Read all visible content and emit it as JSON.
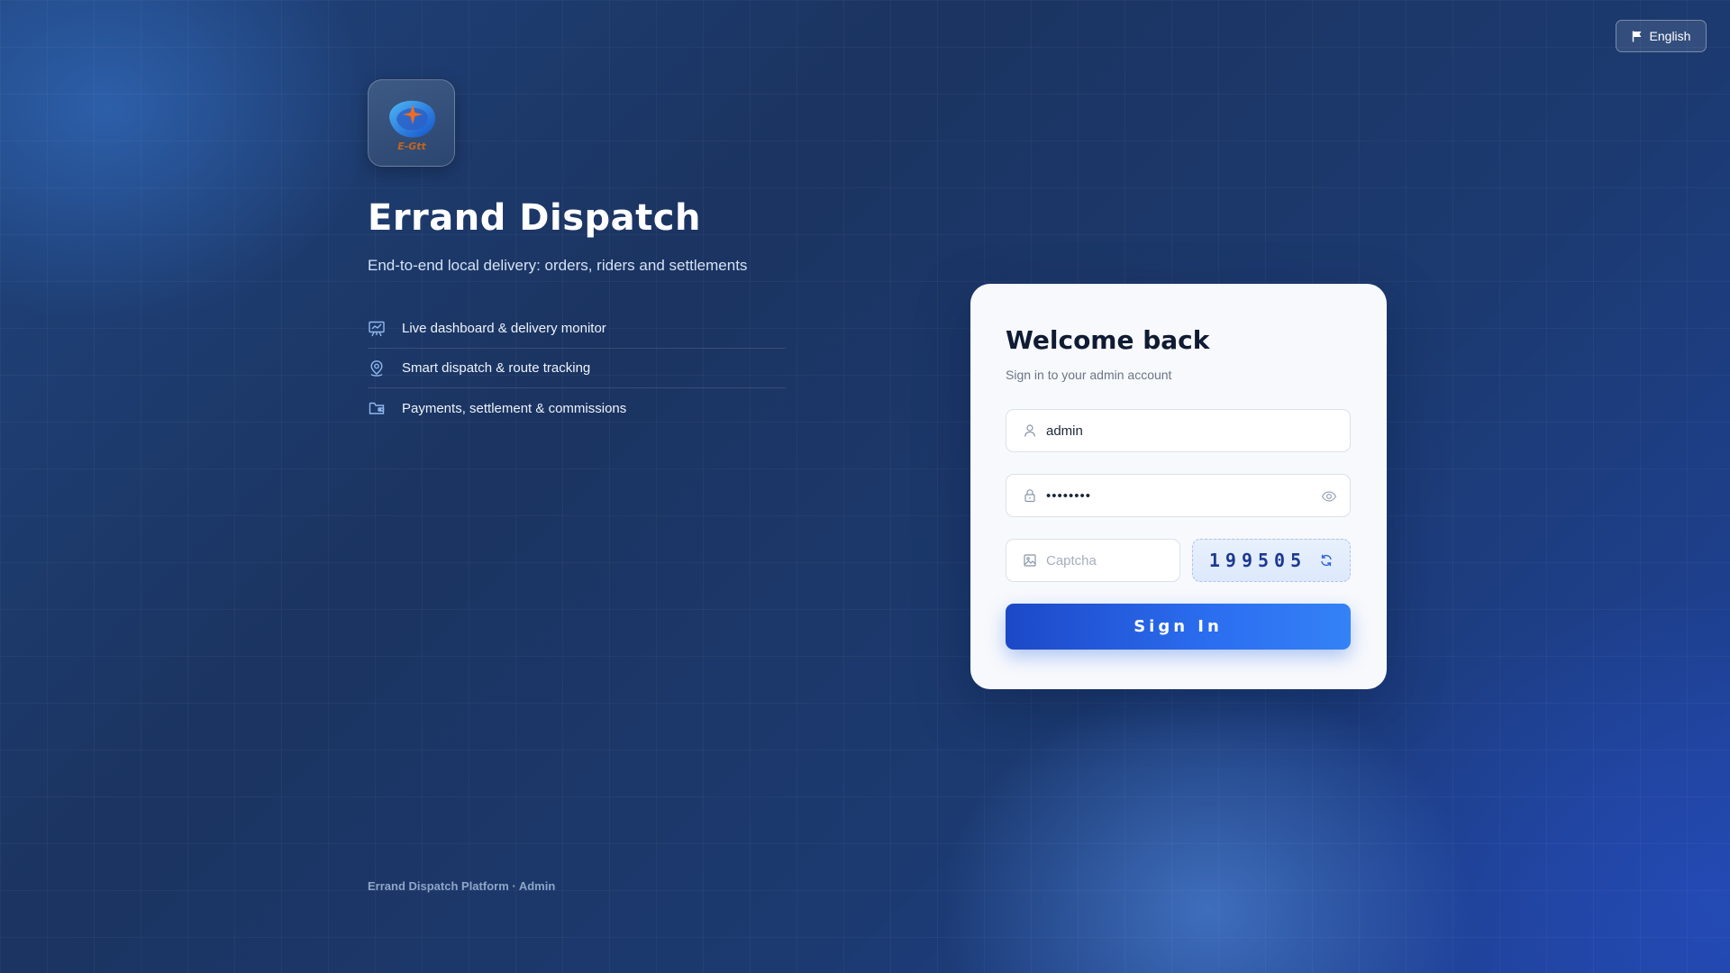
{
  "language": {
    "label": "English",
    "icon": "flag-icon"
  },
  "brand": {
    "logo_text": "E-Gtt",
    "title": "Errand Dispatch",
    "subtitle": "End-to-end local delivery: orders, riders and settlements",
    "features": [
      {
        "icon": "chart-board-icon",
        "label": "Live dashboard & delivery monitor"
      },
      {
        "icon": "location-pin-icon",
        "label": "Smart dispatch & route tracking"
      },
      {
        "icon": "wallet-icon",
        "label": "Payments, settlement & commissions"
      }
    ]
  },
  "footer": {
    "text": "Errand Dispatch Platform · Admin"
  },
  "login": {
    "title": "Welcome back",
    "subtitle": "Sign in to your admin account",
    "username": {
      "value": "admin",
      "icon": "user-icon"
    },
    "password": {
      "value": "••••••••",
      "icon": "lock-icon",
      "toggle_icon": "eye-icon"
    },
    "captcha": {
      "placeholder": "Captcha",
      "icon": "image-icon",
      "code": "199505",
      "refresh_icon": "refresh-icon"
    },
    "submit_label": "Sign In"
  },
  "colors": {
    "accent": "#2b6ef0",
    "card": "#f7f9fc",
    "background": "#1b3461"
  }
}
